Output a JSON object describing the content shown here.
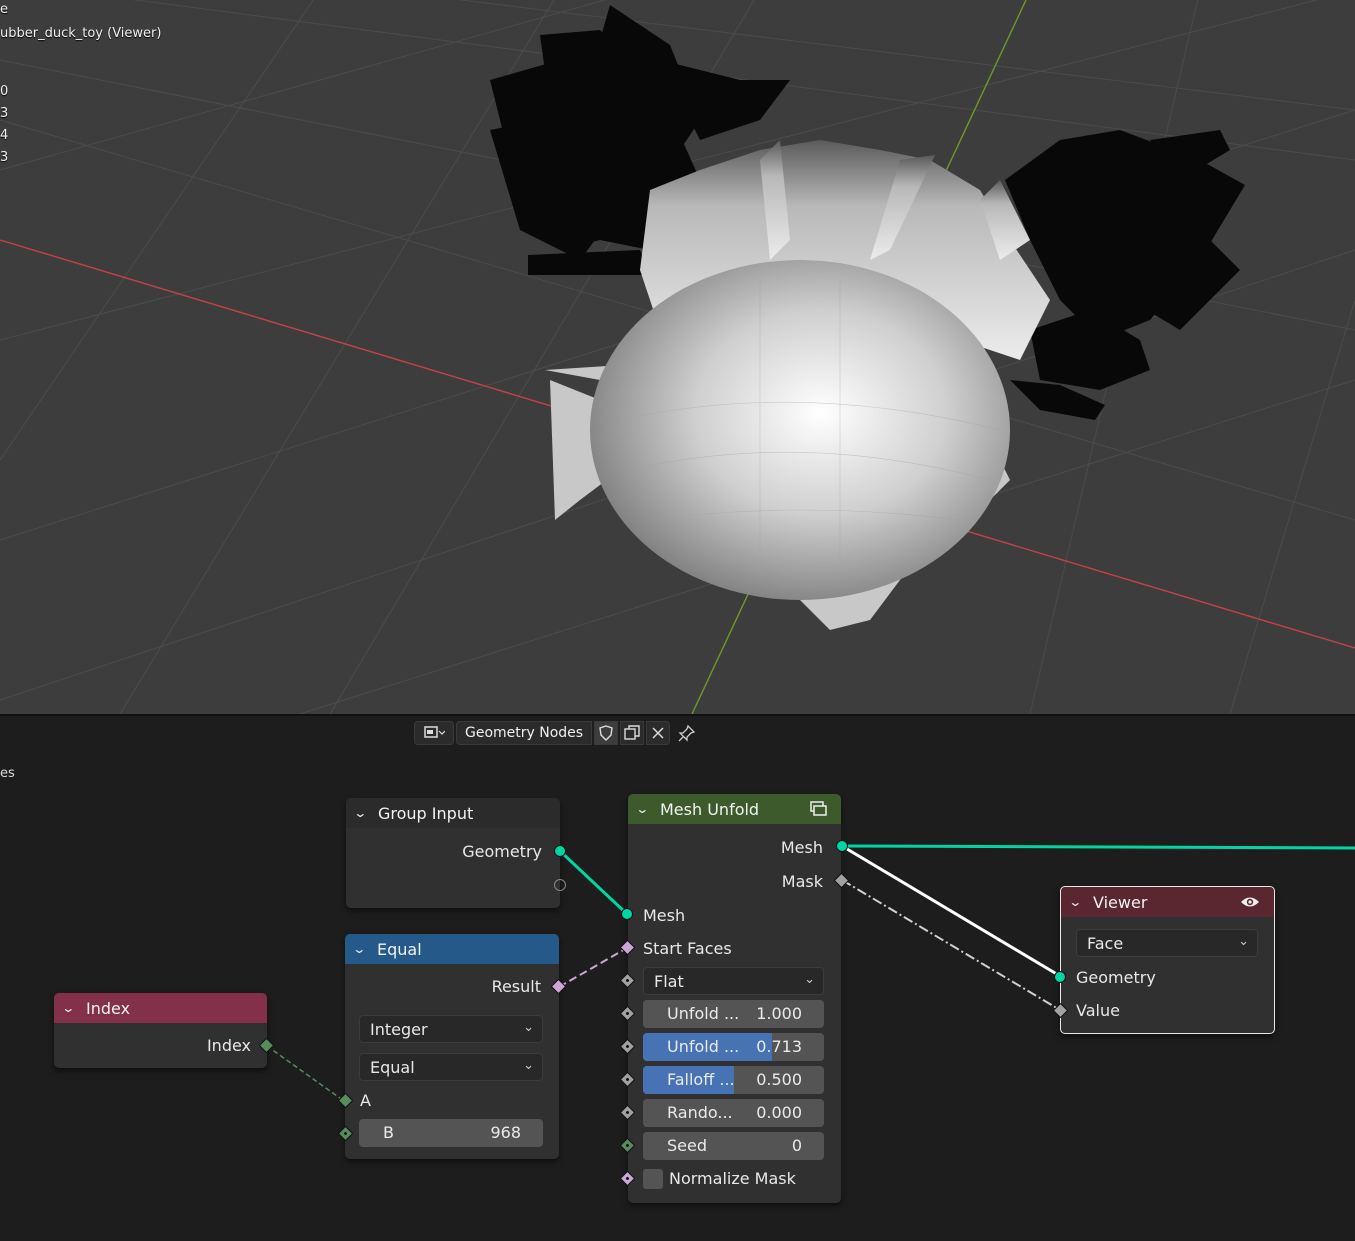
{
  "viewport": {
    "overlay_lines": [
      "e",
      "ubber_duck_toy (Viewer)",
      "0",
      "3",
      "4",
      "3"
    ],
    "axis_colors": {
      "x": "#c4414b",
      "y": "#6d9a27"
    }
  },
  "editor": {
    "left_fragment": "es",
    "tree_name": "Geometry Nodes",
    "header_icons": [
      "editor-type-icon",
      "shield-icon",
      "duplicate-icon",
      "close-icon",
      "pin-icon"
    ]
  },
  "nodes": {
    "group_input": {
      "title": "Group Input",
      "geometry": "Geometry",
      "color": "#2b2b2b"
    },
    "equal": {
      "title": "Equal",
      "result": "Result",
      "data_type": "Integer",
      "operation": "Equal",
      "a": "A",
      "b_label": "B",
      "b_value": "968",
      "color": "#24598a"
    },
    "index": {
      "title": "Index",
      "output": "Index",
      "color": "#83314a"
    },
    "mesh_unfold": {
      "title": "Mesh Unfold",
      "color": "#3c5a2b",
      "out_mesh": "Mesh",
      "out_mask": "Mask",
      "in_mesh": "Mesh",
      "start_faces": "Start Faces",
      "mode": "Flat",
      "fields": [
        {
          "label": "Unfold ...",
          "value": "1.000",
          "fill": 0
        },
        {
          "label": "Unfold ...",
          "value": "0.713",
          "fill": 0.713
        },
        {
          "label": "Falloff ...",
          "value": "0.500",
          "fill": 0.5
        },
        {
          "label": "Rando...",
          "value": "0.000",
          "fill": 0
        },
        {
          "label": "Seed",
          "value": "0",
          "fill": 0
        }
      ],
      "normalize": "Normalize Mask"
    },
    "viewer": {
      "title": "Viewer",
      "domain": "Face",
      "geometry": "Geometry",
      "value": "Value",
      "color": "#5a2630"
    }
  }
}
